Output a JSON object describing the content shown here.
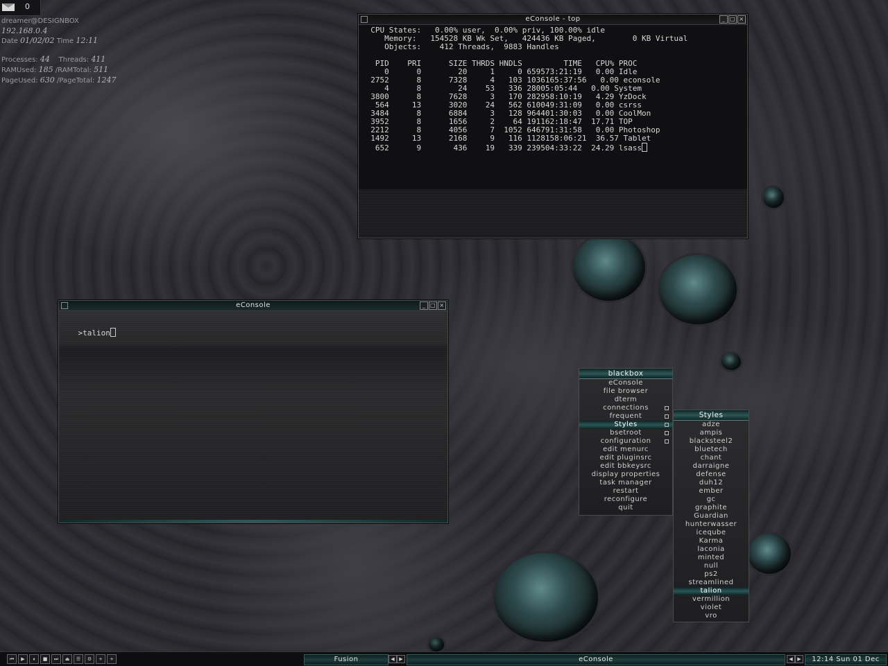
{
  "tray": {
    "mail_count": "0"
  },
  "sysinfo": {
    "user": "dreamer@DESIGNBOX",
    "ip": "192.168.0.4",
    "date_label": "Date",
    "date": "01/02/02",
    "time_label": "Time",
    "time": "12:11",
    "processes_label": "Processes:",
    "processes": "44",
    "threads_label": "Threads:",
    "threads": "411",
    "ramused_label": "RAMUsed:",
    "ramused": "185",
    "ramtotal_label": "/RAMTotal:",
    "ramtotal": "511",
    "pageused_label": "PageUsed:",
    "pageused": "630",
    "pagetotal_label": "/PageTotal:",
    "pagetotal": "1247"
  },
  "top_window": {
    "title": "eConsole - top",
    "lines": [
      "  CPU States:   0.00% user,  0.00% priv, 100.00% idle",
      "     Memory:   154528 KB Wk Set,   424436 KB Paged,        0 KB Virtual",
      "     Objects:    412 Threads,  9883 Handles",
      "",
      "   PID    PRI      SIZE THRDS HNDLS         TIME   CPU% PROC",
      "     0      0        20     1     0 659573:21:19   0.00 Idle",
      "  2752      8      7328     4   103 1036165:37:56   0.00 econsole",
      "     4      8        24    53   336 28005:05:44   0.00 System",
      "  3800      8      7628     3   170 282958:10:19   4.29 YzDock",
      "   564     13      3020    24   562 610049:31:09   0.00 csrss",
      "  3484      8      6884     3   128 964401:30:03   0.00 CoolMon",
      "  3952      8      1656     2    64 191162:18:47  17.71 TOP",
      "  2212      8      4056     7  1052 646791:31:58   0.00 Photoshop",
      "  1492     13      2168     9   116 1128158:06:21  36.57 Tablet",
      "   652      9       436    19   339 239504:33:22  24.29 lsass"
    ]
  },
  "console_window": {
    "title": "eConsole",
    "prompt": ">",
    "input": "talion"
  },
  "blackbox_menu": {
    "title": "blackbox",
    "items": [
      {
        "label": "eConsole",
        "sub": false,
        "hl": false
      },
      {
        "label": "file browser",
        "sub": false,
        "hl": false
      },
      {
        "label": "dterm",
        "sub": false,
        "hl": false
      },
      {
        "label": "connections",
        "sub": true,
        "hl": false
      },
      {
        "label": "frequent",
        "sub": true,
        "hl": false
      },
      {
        "label": "Styles",
        "sub": true,
        "hl": true
      },
      {
        "label": "bsetroot",
        "sub": true,
        "hl": false
      },
      {
        "label": "configuration",
        "sub": true,
        "hl": false
      },
      {
        "label": "edit menurc",
        "sub": false,
        "hl": false
      },
      {
        "label": "edit pluginsrc",
        "sub": false,
        "hl": false
      },
      {
        "label": "edit bbkeysrc",
        "sub": false,
        "hl": false
      },
      {
        "label": "display properties",
        "sub": false,
        "hl": false
      },
      {
        "label": "task manager",
        "sub": false,
        "hl": false
      },
      {
        "label": "restart",
        "sub": false,
        "hl": false
      },
      {
        "label": "reconfigure",
        "sub": false,
        "hl": false
      },
      {
        "label": "quit",
        "sub": false,
        "hl": false
      }
    ]
  },
  "styles_menu": {
    "title": "Styles",
    "items": [
      "adze",
      "ampis",
      "blacksteel2",
      "bluetech",
      "chant",
      "darraigne",
      "defense",
      "duh12",
      "ember",
      "gc",
      "graphite",
      "Guardian",
      "hunterwasser",
      "iceqube",
      "Karma",
      "laconia",
      "minted",
      "null",
      "ps2",
      "streamlined",
      "talion",
      "vermillion",
      "violet",
      "vro"
    ],
    "selected": "talion"
  },
  "taskbar": {
    "media_buttons": [
      "⏮",
      "▶",
      "⏸",
      "■",
      "⏭",
      "⏏",
      "☰",
      "⚙",
      "+",
      "+"
    ],
    "workspace": "Fusion",
    "active_task": "eConsole",
    "clock": "12:14 Sun 01 Dec"
  },
  "colors": {
    "accent": "#2e5656",
    "bg": "#2c2b31"
  }
}
